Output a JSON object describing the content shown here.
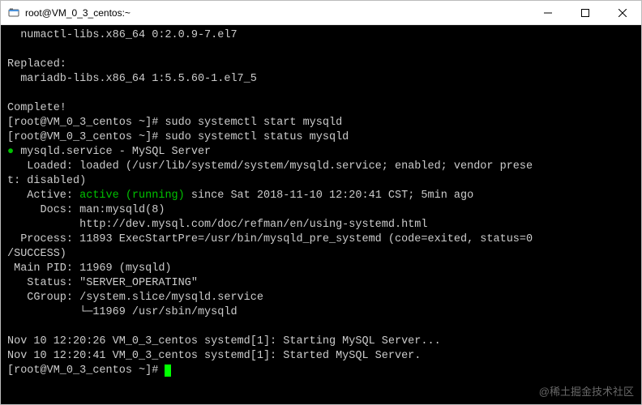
{
  "window": {
    "title": "root@VM_0_3_centos:~"
  },
  "terminal": {
    "line1": "  numactl-libs.x86_64 0:2.0.9-7.el7",
    "blank": "",
    "replaced_hdr": "Replaced:",
    "replaced_pkg": "  mariadb-libs.x86_64 1:5.5.60-1.el7_5",
    "complete": "Complete!",
    "prompt": "[root@VM_0_3_centos ~]# ",
    "cmd_start": "sudo systemctl start mysqld",
    "cmd_status": "sudo systemctl status mysqld",
    "svc_bullet": "●",
    "svc_name": " mysqld.service - MySQL Server",
    "loaded": "   Loaded: loaded (/usr/lib/systemd/system/mysqld.service; enabled; vendor prese",
    "loaded2": "t: disabled)",
    "active_lbl": "   Active: ",
    "active_val": "active (running)",
    "active_since": " since Sat 2018-11-10 12:20:41 CST; 5min ago",
    "docs1": "     Docs: man:mysqld(8)",
    "docs2": "           http://dev.mysql.com/doc/refman/en/using-systemd.html",
    "process": "  Process: 11893 ExecStartPre=/usr/bin/mysqld_pre_systemd (code=exited, status=0",
    "process2": "/SUCCESS)",
    "mainpid": " Main PID: 11969 (mysqld)",
    "status": "   Status: \"SERVER_OPERATING\"",
    "cgroup": "   CGroup: /system.slice/mysqld.service",
    "cgroup2": "           └─11969 /usr/sbin/mysqld",
    "log1": "Nov 10 12:20:26 VM_0_3_centos systemd[1]: Starting MySQL Server...",
    "log2": "Nov 10 12:20:41 VM_0_3_centos systemd[1]: Started MySQL Server.",
    "prompt_end": "[root@VM_0_3_centos ~]# "
  },
  "watermark": "@稀土掘金技术社区"
}
